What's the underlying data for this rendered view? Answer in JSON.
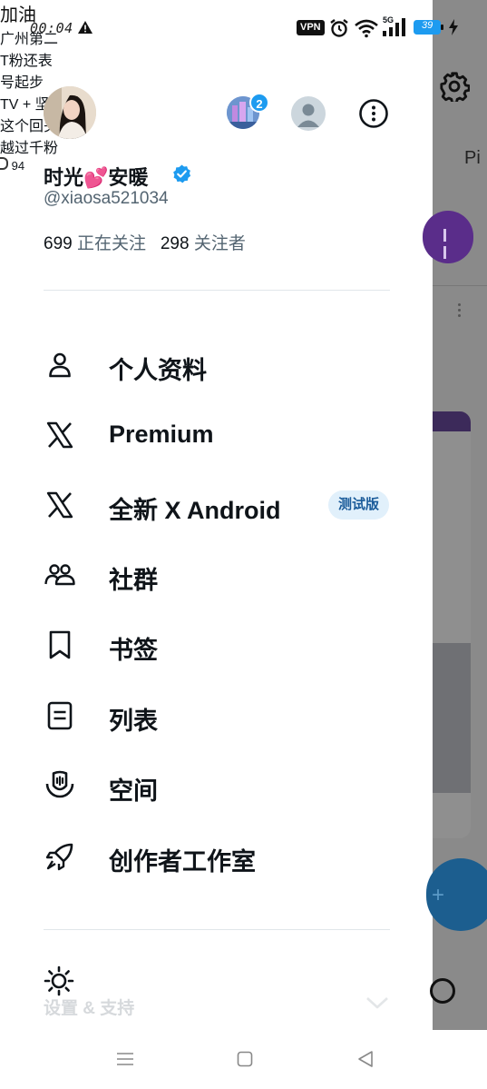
{
  "status_bar": {
    "time": "00:04",
    "vpn": "VPN",
    "network": "5G",
    "battery": "39"
  },
  "background_app": {
    "tab_fragment": "Pi",
    "text_fragments": [
      "加油",
      "广州第二",
      "T粉还表",
      "号起步",
      "TV + 坚",
      "这个回头",
      "越过千粉"
    ],
    "count_fragment": "94"
  },
  "profile": {
    "display_name": "时光💕安暖",
    "handle": "@xiaosa521034",
    "following_count": "699",
    "following_label": "正在关注",
    "followers_count": "298",
    "followers_label": "关注者",
    "account_badge_count": "2"
  },
  "menu": {
    "items": [
      {
        "label": "个人资料",
        "icon": "person-icon"
      },
      {
        "label": "Premium",
        "icon": "x-logo-icon"
      },
      {
        "label": "全新 X Android",
        "icon": "x-logo-icon",
        "badge": "测试版"
      },
      {
        "label": "社群",
        "icon": "communities-icon"
      },
      {
        "label": "书签",
        "icon": "bookmark-icon"
      },
      {
        "label": "列表",
        "icon": "list-icon"
      },
      {
        "label": "空间",
        "icon": "spaces-icon"
      },
      {
        "label": "创作者工作室",
        "icon": "rocket-icon"
      }
    ]
  },
  "settings": {
    "label": "设置 & 支持",
    "icon": "sun-icon"
  },
  "colors": {
    "accent": "#1d9bf0",
    "text": "#0f1419",
    "secondary_text": "#536471",
    "beta_bg": "#e1f0fb",
    "beta_text": "#1a5b9a",
    "overlay": "#8a8a8a"
  }
}
